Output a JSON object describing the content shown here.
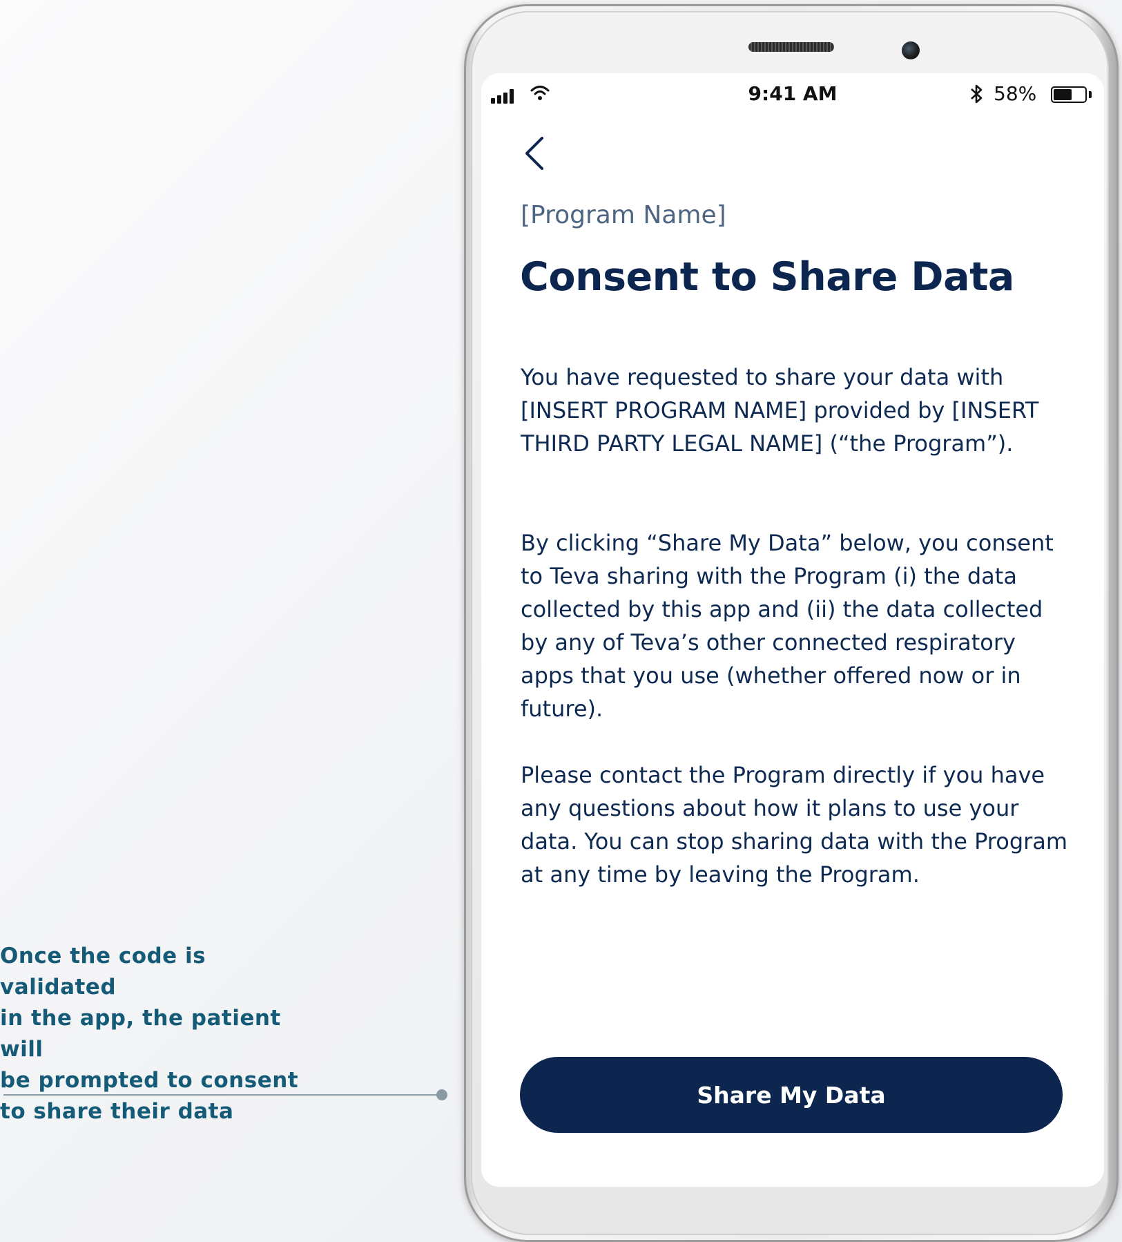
{
  "annotation": {
    "text": "Once the code is validated\nin the app, the patient will\nbe prompted to consent\nto share their data"
  },
  "status_bar": {
    "time": "9:41 AM",
    "battery": "58%",
    "battery_level": 0.58
  },
  "screen": {
    "program_name": "[Program Name]",
    "title": "Consent to Share Data",
    "paragraphs": [
      "You have requested to share your data with [INSERT PROGRAM NAME] provided by [INSERT THIRD PARTY LEGAL NAME] (“the Program”).",
      "By clicking “Share My Data” below, you consent to Teva sharing with the Program (i) the data collected by this app and (ii) the data collected by any of Teva’s other connected respiratory apps that you use (whether offered now or in future).",
      "Please contact the Program directly if you have any questions about how it plans to use your data.  You can stop sharing data with the Program at any time by leaving the Program."
    ],
    "share_button": "Share My Data"
  },
  "colors": {
    "annotation": "#155b78",
    "navy": "#0d2650",
    "program_name": "#4d6580"
  },
  "icons": [
    "signal-icon",
    "wifi-icon",
    "bluetooth-icon",
    "battery-icon",
    "back-chevron-icon"
  ]
}
